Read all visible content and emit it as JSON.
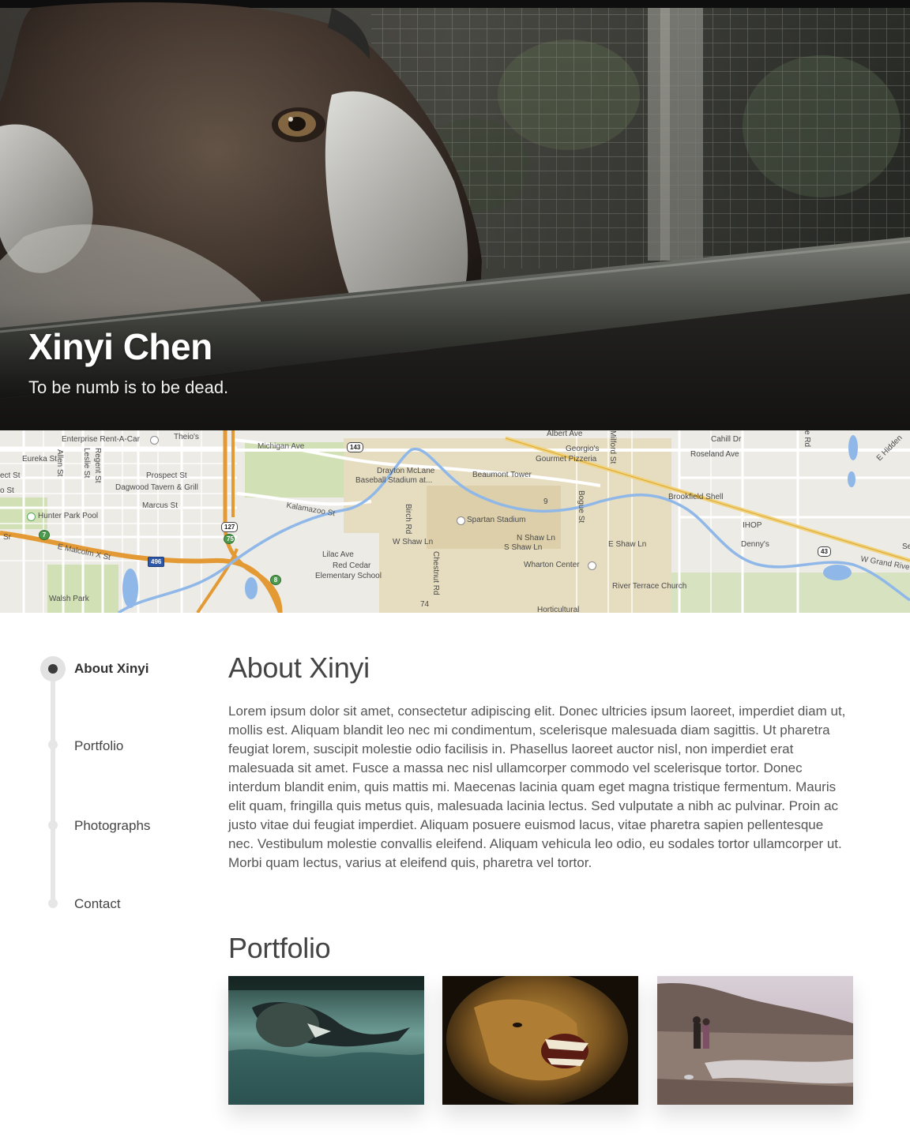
{
  "hero": {
    "name": "Xinyi Chen",
    "tagline": "To be numb is to be dead."
  },
  "map": {
    "labels": {
      "enterprise": "Enterprise Rent-A-Car",
      "theios": "Theio's",
      "michigan_ave": "Michigan Ave",
      "albert_ave": "Albert Ave",
      "georgios": "Georgio's",
      "gourmet_pizzeria": "Gourmet Pizzeria",
      "milford_st": "Milford St",
      "abbott": "Abbott Rd",
      "cahill_dr": "Cahill Dr",
      "roseland_ave": "Roseland Ave",
      "e_hidden": "E Hidden",
      "eureka_st": "Eureka St",
      "allen_st": "Allen St",
      "regent_st": "Regent St",
      "leslie_st": "Leslie St",
      "ect_st": "ect St",
      "o_st": "o St",
      "prospect_st": "Prospect St",
      "dagwood": "Dagwood Tavern & Grill",
      "marcus_st": "Marcus St",
      "drayton": "Drayton McLane",
      "baseball": "Baseball Stadium at...",
      "beaumont": "Beaumont Tower",
      "bogue_st": "Bogue St",
      "brookfield": "Brookfield Shell",
      "kalamazoo": "Kalamazoo St",
      "hunter_park": "Hunter Park Pool",
      "birch_rd": "Birch Rd",
      "spartan": "Spartan Stadium",
      "ihop": "IHOP",
      "w_sr": "Sr",
      "dennys": "Denny's",
      "e_malcolm": "E Malcolm X St",
      "w_shaw_ln": "W Shaw Ln",
      "n_shaw_ln": "N Shaw Ln",
      "s_shaw_ln": "S Shaw Ln",
      "e_shaw_ln": "E Shaw Ln",
      "w_grand_river": "W Grand Rive",
      "se": "Se",
      "lilac_ave": "Lilac Ave",
      "red_cedar": "Red Cedar",
      "elementary": "Elementary School",
      "chestnut_rd": "Chestnut Rd",
      "wharton": "Wharton Center",
      "river_terrace": "River Terrace Church",
      "walsh_park": "Walsh Park",
      "horticultural": "Horticultural",
      "e_rd": "e Rd"
    },
    "shields": {
      "r143": "143",
      "r127": "127",
      "r75": "75",
      "r496": "496",
      "r7": "7",
      "r8": "8",
      "r43": "43",
      "r9": "9",
      "r74": "74"
    }
  },
  "nav": {
    "items": [
      {
        "label": "About Xinyi",
        "active": true
      },
      {
        "label": "Portfolio",
        "active": false
      },
      {
        "label": "Photographs",
        "active": false
      },
      {
        "label": "Contact",
        "active": false
      }
    ]
  },
  "about": {
    "title": "About Xinyi",
    "body": "Lorem ipsum dolor sit amet, consectetur adipiscing elit. Donec ultricies ipsum laoreet, imperdiet diam ut, mollis est. Aliquam blandit leo nec mi condimentum, scelerisque malesuada diam sagittis. Ut pharetra feugiat lorem, suscipit molestie odio facilisis in. Phasellus laoreet auctor nisl, non imperdiet erat malesuada sit amet. Fusce a massa nec nisl ullamcorper commodo vel scelerisque tortor. Donec interdum blandit enim, quis mattis mi. Maecenas lacinia quam eget magna tristique fermentum. Mauris elit quam, fringilla quis metus quis, malesuada lacinia lectus. Sed vulputate a nibh ac pulvinar. Proin ac justo vitae dui feugiat imperdiet. Aliquam posuere euismod lacus, vitae pharetra sapien pellentesque nec. Vestibulum molestie convallis eleifend. Aliquam vehicula leo odio, eu sodales tortor ullamcorper ut. Morbi quam lectus, varius at eleifend quis, pharetra vel tortor."
  },
  "portfolio": {
    "title": "Portfolio",
    "items": [
      {
        "icon": "underwater-seal-photo"
      },
      {
        "icon": "roaring-lion-photo"
      },
      {
        "icon": "beach-couple-photo"
      }
    ]
  }
}
